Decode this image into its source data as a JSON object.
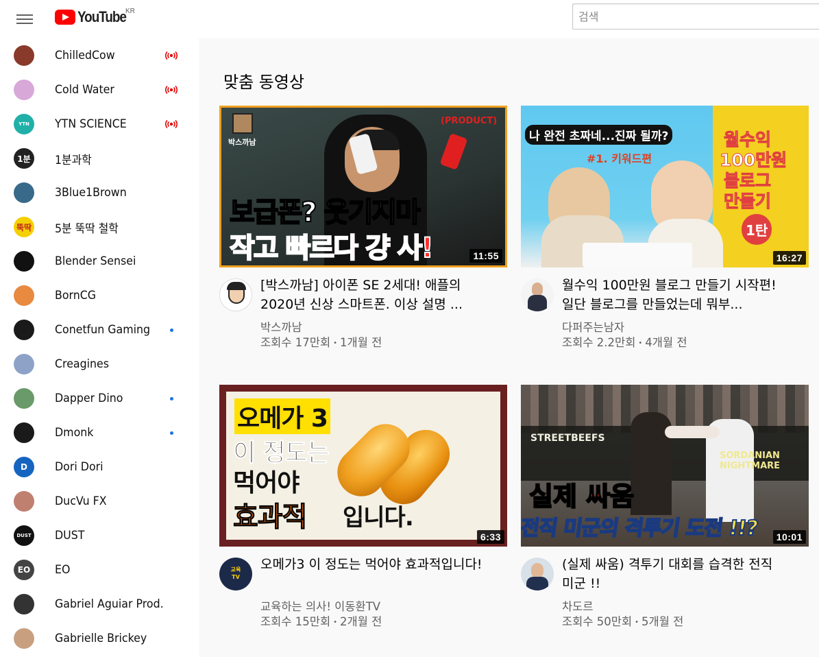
{
  "header": {
    "logo_text": "YouTube",
    "region": "KR",
    "search_placeholder": "검색"
  },
  "sidebar": {
    "subscriptions": [
      {
        "name": "ChilledCow",
        "status": "live",
        "avatar_color": "#8a3a2a"
      },
      {
        "name": "Cold Water",
        "status": "live",
        "avatar_color": "#d8a8d8"
      },
      {
        "name": "YTN SCIENCE",
        "status": "live",
        "avatar_color": "#20b0a8"
      },
      {
        "name": "1분과학",
        "status": "none",
        "avatar_color": "#222222"
      },
      {
        "name": "3Blue1Brown",
        "status": "none",
        "avatar_color": "#3a6a8a"
      },
      {
        "name": "5분 뚝딱 철학",
        "status": "none",
        "avatar_color": "#f5d000"
      },
      {
        "name": "Blender Sensei",
        "status": "none",
        "avatar_color": "#111111"
      },
      {
        "name": "BornCG",
        "status": "none",
        "avatar_color": "#e88a40"
      },
      {
        "name": "Conetfun Gaming",
        "status": "new",
        "avatar_color": "#1a1a1a"
      },
      {
        "name": "Creagines",
        "status": "none",
        "avatar_color": "#8ea2c8"
      },
      {
        "name": "Dapper Dino",
        "status": "new",
        "avatar_color": "#6a9a6a"
      },
      {
        "name": "Dmonk",
        "status": "new",
        "avatar_color": "#1a1a1a"
      },
      {
        "name": "Dori Dori",
        "status": "none",
        "avatar_color": "#1565c0"
      },
      {
        "name": "DucVu FX",
        "status": "none",
        "avatar_color": "#c08070"
      },
      {
        "name": "DUST",
        "status": "none",
        "avatar_color": "#111111"
      },
      {
        "name": "EO",
        "status": "none",
        "avatar_color": "#444444"
      },
      {
        "name": "Gabriel Aguiar Prod.",
        "status": "none",
        "avatar_color": "#333333"
      },
      {
        "name": "Gabrielle Brickey",
        "status": "none",
        "avatar_color": "#c8a080"
      }
    ],
    "avatar_marks": {
      "YTN SCIENCE": "YTN",
      "1분과학": "1분",
      "5분 뚝딱 철학": "뚝딱",
      "Dori Dori": "D",
      "DUST": "DUST",
      "EO": "EO"
    }
  },
  "main": {
    "section_title": "맞춤 동영상",
    "videos": [
      {
        "title": "[박스까남] 아이폰 SE 2세대! 애플의 2020년 신상 스마트폰. 이상 설명 ...",
        "channel": "박스까남",
        "views": "조회수 17만회",
        "age": "1개월 전",
        "duration": "11:55",
        "thumb_texts": [
          "박스까남",
          "(PRODUCT)",
          "보급폰? 웃기지마",
          "작고 빠르다 걍 사!"
        ]
      },
      {
        "title": "월수익 100만원 블로그 만들기 시작편!일단 블로그를 만들었는데 뭐부...",
        "channel": "다퍼주는남자",
        "views": "조회수 2.2만회",
        "age": "4개월 전",
        "duration": "16:27",
        "thumb_texts": [
          "나 완전 초짜네...진짜 될까?",
          "#1. 키워드편",
          "월수익",
          "100만원",
          "블로그",
          "만들기",
          "1탄"
        ]
      },
      {
        "title": "오메가3 이 정도는 먹어야 효과적입니다!",
        "channel": "교육하는 의사! 이동환TV",
        "views": "조회수 15만회",
        "age": "2개월 전",
        "duration": "6:33",
        "thumb_texts": [
          "오메가 3",
          "이 정도는",
          "먹어야",
          "효과적",
          "입니다."
        ]
      },
      {
        "title": "(실제 싸움) 격투기 대회를 습격한 전직 미군 !!",
        "channel": "차도르",
        "views": "조회수 50만회",
        "age": "5개월 전",
        "duration": "10:01",
        "thumb_texts": [
          "STREETBEEFS",
          "SORDANIAN NIGHTMARE",
          "실제 싸움",
          "전직 미군의 격투기 도전 !!?"
        ]
      }
    ],
    "meta_separator": "•"
  }
}
